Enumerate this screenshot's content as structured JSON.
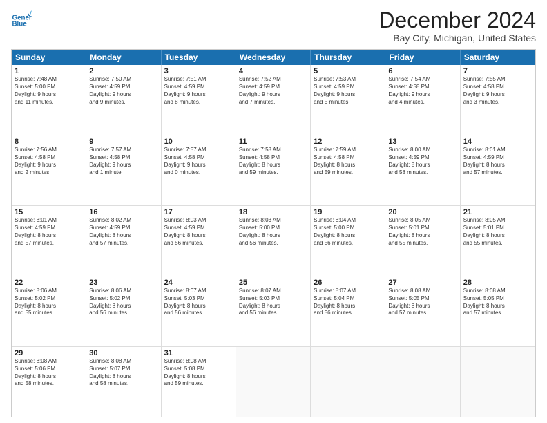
{
  "header": {
    "logo_line1": "General",
    "logo_line2": "Blue",
    "month": "December 2024",
    "location": "Bay City, Michigan, United States"
  },
  "days_of_week": [
    "Sunday",
    "Monday",
    "Tuesday",
    "Wednesday",
    "Thursday",
    "Friday",
    "Saturday"
  ],
  "weeks": [
    [
      {
        "day": 1,
        "lines": [
          "Sunrise: 7:48 AM",
          "Sunset: 5:00 PM",
          "Daylight: 9 hours",
          "and 11 minutes."
        ]
      },
      {
        "day": 2,
        "lines": [
          "Sunrise: 7:50 AM",
          "Sunset: 4:59 PM",
          "Daylight: 9 hours",
          "and 9 minutes."
        ]
      },
      {
        "day": 3,
        "lines": [
          "Sunrise: 7:51 AM",
          "Sunset: 4:59 PM",
          "Daylight: 9 hours",
          "and 8 minutes."
        ]
      },
      {
        "day": 4,
        "lines": [
          "Sunrise: 7:52 AM",
          "Sunset: 4:59 PM",
          "Daylight: 9 hours",
          "and 7 minutes."
        ]
      },
      {
        "day": 5,
        "lines": [
          "Sunrise: 7:53 AM",
          "Sunset: 4:59 PM",
          "Daylight: 9 hours",
          "and 5 minutes."
        ]
      },
      {
        "day": 6,
        "lines": [
          "Sunrise: 7:54 AM",
          "Sunset: 4:58 PM",
          "Daylight: 9 hours",
          "and 4 minutes."
        ]
      },
      {
        "day": 7,
        "lines": [
          "Sunrise: 7:55 AM",
          "Sunset: 4:58 PM",
          "Daylight: 9 hours",
          "and 3 minutes."
        ]
      }
    ],
    [
      {
        "day": 8,
        "lines": [
          "Sunrise: 7:56 AM",
          "Sunset: 4:58 PM",
          "Daylight: 9 hours",
          "and 2 minutes."
        ]
      },
      {
        "day": 9,
        "lines": [
          "Sunrise: 7:57 AM",
          "Sunset: 4:58 PM",
          "Daylight: 9 hours",
          "and 1 minute."
        ]
      },
      {
        "day": 10,
        "lines": [
          "Sunrise: 7:57 AM",
          "Sunset: 4:58 PM",
          "Daylight: 9 hours",
          "and 0 minutes."
        ]
      },
      {
        "day": 11,
        "lines": [
          "Sunrise: 7:58 AM",
          "Sunset: 4:58 PM",
          "Daylight: 8 hours",
          "and 59 minutes."
        ]
      },
      {
        "day": 12,
        "lines": [
          "Sunrise: 7:59 AM",
          "Sunset: 4:58 PM",
          "Daylight: 8 hours",
          "and 59 minutes."
        ]
      },
      {
        "day": 13,
        "lines": [
          "Sunrise: 8:00 AM",
          "Sunset: 4:59 PM",
          "Daylight: 8 hours",
          "and 58 minutes."
        ]
      },
      {
        "day": 14,
        "lines": [
          "Sunrise: 8:01 AM",
          "Sunset: 4:59 PM",
          "Daylight: 8 hours",
          "and 57 minutes."
        ]
      }
    ],
    [
      {
        "day": 15,
        "lines": [
          "Sunrise: 8:01 AM",
          "Sunset: 4:59 PM",
          "Daylight: 8 hours",
          "and 57 minutes."
        ]
      },
      {
        "day": 16,
        "lines": [
          "Sunrise: 8:02 AM",
          "Sunset: 4:59 PM",
          "Daylight: 8 hours",
          "and 57 minutes."
        ]
      },
      {
        "day": 17,
        "lines": [
          "Sunrise: 8:03 AM",
          "Sunset: 4:59 PM",
          "Daylight: 8 hours",
          "and 56 minutes."
        ]
      },
      {
        "day": 18,
        "lines": [
          "Sunrise: 8:03 AM",
          "Sunset: 5:00 PM",
          "Daylight: 8 hours",
          "and 56 minutes."
        ]
      },
      {
        "day": 19,
        "lines": [
          "Sunrise: 8:04 AM",
          "Sunset: 5:00 PM",
          "Daylight: 8 hours",
          "and 56 minutes."
        ]
      },
      {
        "day": 20,
        "lines": [
          "Sunrise: 8:05 AM",
          "Sunset: 5:01 PM",
          "Daylight: 8 hours",
          "and 55 minutes."
        ]
      },
      {
        "day": 21,
        "lines": [
          "Sunrise: 8:05 AM",
          "Sunset: 5:01 PM",
          "Daylight: 8 hours",
          "and 55 minutes."
        ]
      }
    ],
    [
      {
        "day": 22,
        "lines": [
          "Sunrise: 8:06 AM",
          "Sunset: 5:02 PM",
          "Daylight: 8 hours",
          "and 55 minutes."
        ]
      },
      {
        "day": 23,
        "lines": [
          "Sunrise: 8:06 AM",
          "Sunset: 5:02 PM",
          "Daylight: 8 hours",
          "and 56 minutes."
        ]
      },
      {
        "day": 24,
        "lines": [
          "Sunrise: 8:07 AM",
          "Sunset: 5:03 PM",
          "Daylight: 8 hours",
          "and 56 minutes."
        ]
      },
      {
        "day": 25,
        "lines": [
          "Sunrise: 8:07 AM",
          "Sunset: 5:03 PM",
          "Daylight: 8 hours",
          "and 56 minutes."
        ]
      },
      {
        "day": 26,
        "lines": [
          "Sunrise: 8:07 AM",
          "Sunset: 5:04 PM",
          "Daylight: 8 hours",
          "and 56 minutes."
        ]
      },
      {
        "day": 27,
        "lines": [
          "Sunrise: 8:08 AM",
          "Sunset: 5:05 PM",
          "Daylight: 8 hours",
          "and 57 minutes."
        ]
      },
      {
        "day": 28,
        "lines": [
          "Sunrise: 8:08 AM",
          "Sunset: 5:05 PM",
          "Daylight: 8 hours",
          "and 57 minutes."
        ]
      }
    ],
    [
      {
        "day": 29,
        "lines": [
          "Sunrise: 8:08 AM",
          "Sunset: 5:06 PM",
          "Daylight: 8 hours",
          "and 58 minutes."
        ]
      },
      {
        "day": 30,
        "lines": [
          "Sunrise: 8:08 AM",
          "Sunset: 5:07 PM",
          "Daylight: 8 hours",
          "and 58 minutes."
        ]
      },
      {
        "day": 31,
        "lines": [
          "Sunrise: 8:08 AM",
          "Sunset: 5:08 PM",
          "Daylight: 8 hours",
          "and 59 minutes."
        ]
      },
      null,
      null,
      null,
      null
    ]
  ]
}
